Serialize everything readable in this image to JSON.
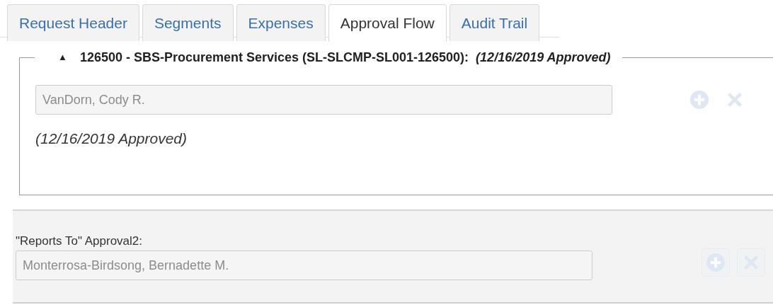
{
  "tabs": [
    {
      "label": "Request Header",
      "selected": false
    },
    {
      "label": "Segments",
      "selected": false
    },
    {
      "label": "Expenses",
      "selected": false
    },
    {
      "label": "Approval Flow",
      "selected": true
    },
    {
      "label": "Audit Trail",
      "selected": false
    }
  ],
  "approval_group": {
    "toggle": "▲",
    "expanded": true,
    "title": "126500 - SBS-Procurement Services (SL-SLCMP-SL001-126500):",
    "status": "(12/16/2019 Approved)",
    "approver": {
      "value": "VanDorn, Cody R.",
      "disabled": true
    },
    "approval_status": "(12/16/2019 Approved)"
  },
  "reports_to": {
    "label": "\"Reports To\" Approval2:",
    "approver": {
      "value": "Monterrosa-Birdsong, Bernadette M.",
      "disabled": true
    }
  }
}
